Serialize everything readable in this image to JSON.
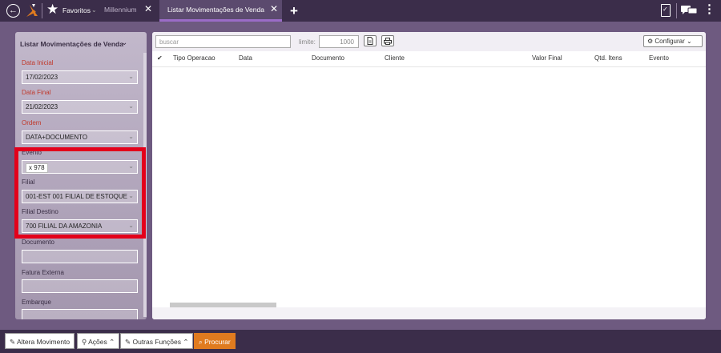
{
  "topbar": {
    "favorites_label": "Favoritos",
    "favorites_caret": "⌄",
    "tabs": [
      {
        "label": "Millennium",
        "close": "✕"
      },
      {
        "label": "Listar Movimentações de Venda",
        "close": "✕"
      }
    ],
    "add_tab": "+",
    "icons": {
      "back": "back-circle-icon",
      "logo": "logo-icon",
      "star": "star-icon",
      "clipboard": "clipboard-icon",
      "chat": "chat-icon",
      "more": "more-vertical-icon"
    }
  },
  "sidebar": {
    "title": "Listar Movimentações de Venda",
    "title_caret": "⌄",
    "filters": {
      "data_inicial": {
        "label": "Data Inicial",
        "value": "17/02/2023"
      },
      "data_final": {
        "label": "Data Final",
        "value": "21/02/2023"
      },
      "ordem": {
        "label": "Ordem",
        "value": "DATA+DOCUMENTO"
      },
      "evento": {
        "label": "Evento",
        "chip_remove": "x",
        "chip_value": "978"
      },
      "filial": {
        "label": "Filial",
        "value": "001-EST 001 FILIAL DE ESTOQUE"
      },
      "filial_destino": {
        "label": "Filial Destino",
        "value": "700 FILIAL DA AMAZONIA"
      },
      "documento": {
        "label": "Documento",
        "value": ""
      },
      "fatura_externa": {
        "label": "Fatura Externa",
        "value": ""
      },
      "embarque": {
        "label": "Embarque",
        "value": ""
      }
    },
    "highlight_color": "#e3001b"
  },
  "main": {
    "search_placeholder": "buscar",
    "limit_label": "limite:",
    "limit_value": "1000",
    "configure_label": "⚙ Configurar ⌄",
    "columns": [
      "✔",
      "Tipo Operacao",
      "Data",
      "Documento",
      "Cliente",
      "Valor Final",
      "Qtd. Itens",
      "Evento"
    ]
  },
  "bottombar": {
    "buttons": [
      {
        "label": "✎ Altera Movimento"
      },
      {
        "label": "⚲ Ações ⌃"
      },
      {
        "label": "✎ Outras Funções ⌃"
      },
      {
        "label": "⌕ Procurar"
      }
    ],
    "accent_color": "#e07b1f"
  }
}
